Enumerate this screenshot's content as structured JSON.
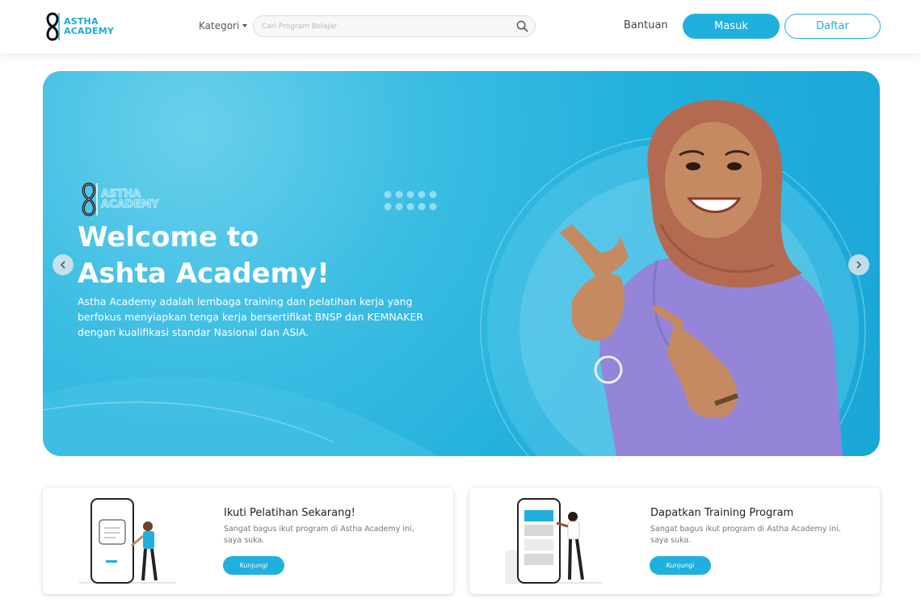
{
  "brand": {
    "logo_line1": "ASTHA",
    "logo_line2": "ACADEMY",
    "accent": "#1fb0dd"
  },
  "navbar": {
    "kategori_label": "Kategori",
    "search_placeholder": "Cari Program Belajar",
    "bantuan_label": "Bantuan",
    "masuk_label": "Masuk",
    "daftar_label": "Daftar"
  },
  "hero": {
    "title_line1": "Welcome to",
    "title_line2": "Ashta Academy!",
    "description": "Astha Academy adalah lembaga training dan pelatihan kerja yang berfokus menyiapkan tenga kerja bersertifikat BNSP dan KEMNAKER dengan kualifikasi standar Nasional dan ASIA."
  },
  "cards": [
    {
      "title": "Ikuti Pelatihan Sekarang!",
      "description": "Sangat bagus ikut program di Astha Academy ini, saya suka.",
      "button_label": "Kunjungi"
    },
    {
      "title": "Dapatkan Training Program",
      "description": "Sangat bagus ikut program di Astha Academy ini, saya suka.",
      "button_label": "Kunjungi"
    }
  ]
}
